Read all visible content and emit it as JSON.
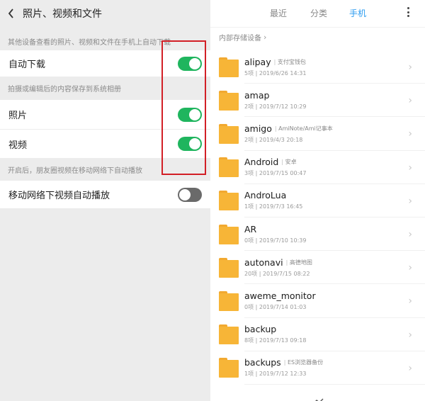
{
  "left": {
    "title": "照片、视频和文件",
    "section1_label": "其他设备查看的照片、视频和文件在手机上自动下载",
    "auto_download": {
      "label": "自动下载",
      "state": "on"
    },
    "section2_label": "拍摄或编辑后的内容保存到系统相册",
    "photos": {
      "label": "照片",
      "state": "on"
    },
    "videos": {
      "label": "视频",
      "state": "on"
    },
    "section3_label": "开启后，朋友圈视频在移动网络下自动播放",
    "mobile_autoplay": {
      "label": "移动网络下视频自动播放",
      "state": "off"
    }
  },
  "right": {
    "tabs": [
      "最近",
      "分类",
      "手机"
    ],
    "active_tab": "手机",
    "path": "内部存储设备",
    "files": [
      {
        "name": "alipay",
        "tag": "支付宝钱包",
        "meta": "5项 | 2019/6/26 14:31"
      },
      {
        "name": "amap",
        "tag": "",
        "meta": "2项 | 2019/7/12 10:29"
      },
      {
        "name": "amigo",
        "tag": "AmiNote/Ami记事本",
        "meta": "2项 | 2019/4/3 20:18"
      },
      {
        "name": "Android",
        "tag": "安卓",
        "meta": "3项 | 2019/7/15 00:47"
      },
      {
        "name": "AndroLua",
        "tag": "",
        "meta": "1项 | 2019/7/3 16:45"
      },
      {
        "name": "AR",
        "tag": "",
        "meta": "0项 | 2019/7/10 10:39"
      },
      {
        "name": "autonavi",
        "tag": "高德地图",
        "meta": "20项 | 2019/7/15 08:22"
      },
      {
        "name": "aweme_monitor",
        "tag": "",
        "meta": "0项 | 2019/7/14 01:03"
      },
      {
        "name": "backup",
        "tag": "",
        "meta": "8项 | 2019/7/13 09:18"
      },
      {
        "name": "backups",
        "tag": "ES浏览器备份",
        "meta": "1项 | 2019/7/12 12:33"
      }
    ]
  },
  "colors": {
    "toggle_on": "#1fb55e",
    "toggle_off": "#6a6a6a",
    "accent_tab": "#2c9cf0",
    "folder": "#f7b537",
    "highlight": "#d21f26"
  }
}
